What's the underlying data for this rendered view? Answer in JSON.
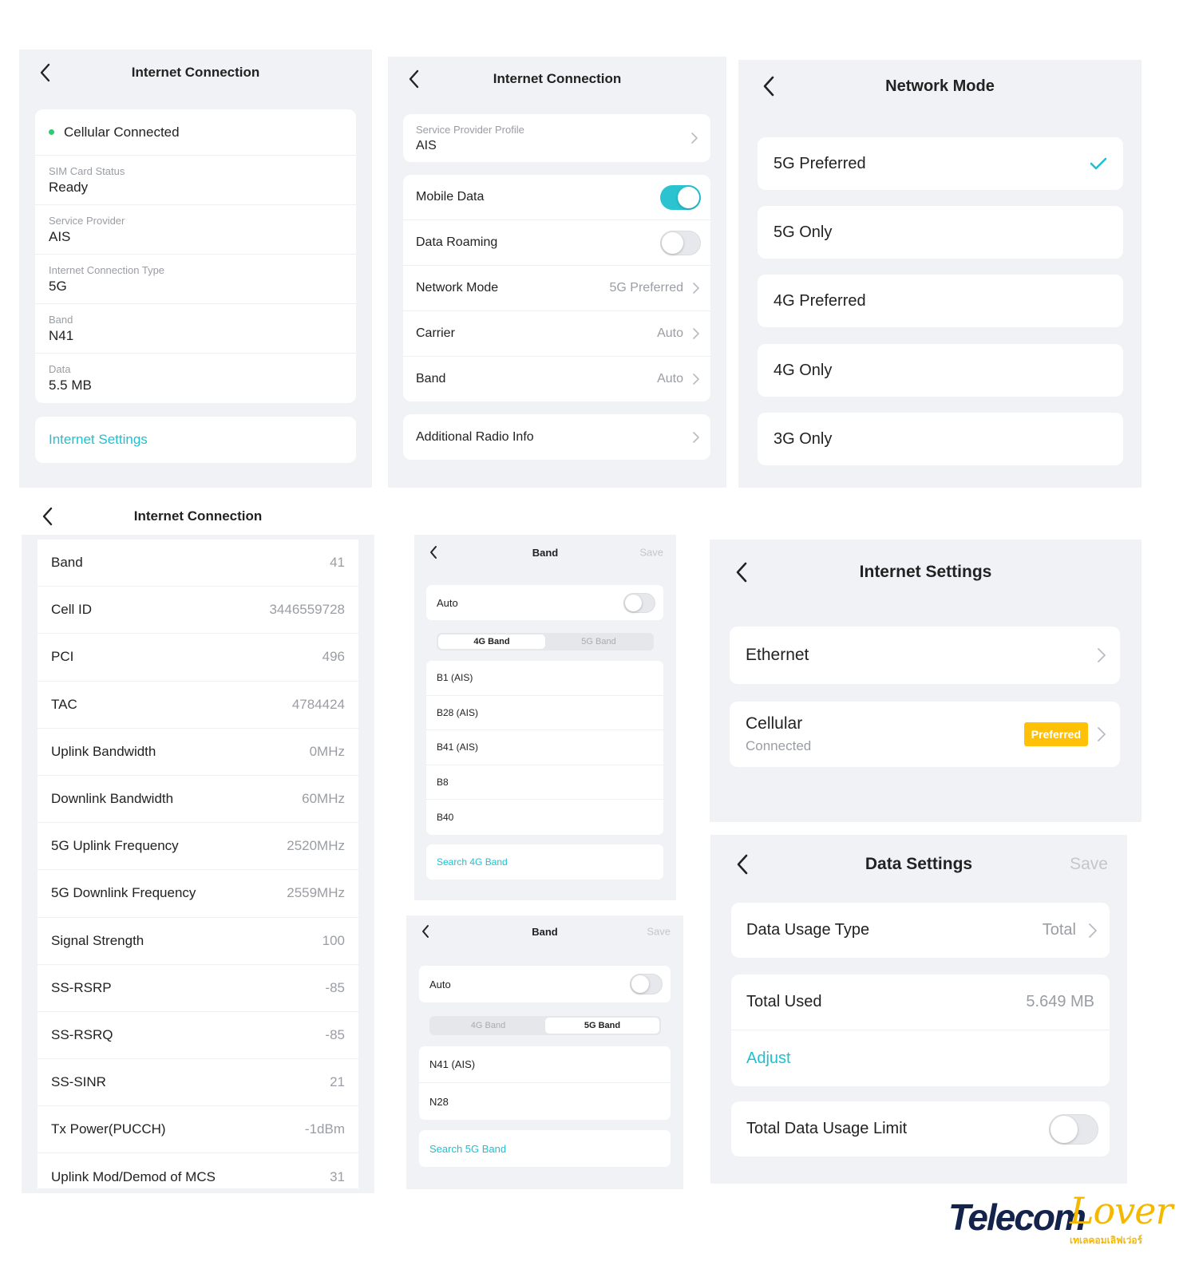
{
  "p1": {
    "title": "Internet Connection",
    "status": "Cellular Connected",
    "status_color": "#2ecc71",
    "fields": [
      {
        "label": "SIM Card Status",
        "value": "Ready"
      },
      {
        "label": "Service Provider",
        "value": "AIS"
      },
      {
        "label": "Internet Connection Type",
        "value": "5G"
      },
      {
        "label": "Band",
        "value": "N41"
      },
      {
        "label": "Data",
        "value": "5.5 MB"
      }
    ],
    "settings_link": "Internet Settings"
  },
  "p2": {
    "title": "Internet Connection",
    "profile_label": "Service Provider Profile",
    "profile_value": "AIS",
    "mobile_data": {
      "label": "Mobile Data",
      "on": true
    },
    "data_roaming": {
      "label": "Data Roaming",
      "on": false
    },
    "rows": [
      {
        "label": "Network Mode",
        "value": "5G Preferred"
      },
      {
        "label": "Carrier",
        "value": "Auto"
      },
      {
        "label": "Band",
        "value": "Auto"
      }
    ],
    "radio_info": "Additional Radio Info"
  },
  "p3": {
    "title": "Network Mode",
    "options": [
      "5G Preferred",
      "5G Only",
      "4G Preferred",
      "4G Only",
      "3G Only"
    ],
    "selected": "5G Preferred"
  },
  "p4": {
    "title": "Internet Connection",
    "rows": [
      {
        "label": "Band",
        "value": "41"
      },
      {
        "label": "Cell ID",
        "value": "3446559728"
      },
      {
        "label": "PCI",
        "value": "496"
      },
      {
        "label": "TAC",
        "value": "4784424"
      },
      {
        "label": "Uplink Bandwidth",
        "value": "0MHz"
      },
      {
        "label": "Downlink Bandwidth",
        "value": "60MHz"
      },
      {
        "label": "5G Uplink Frequency",
        "value": "2520MHz"
      },
      {
        "label": "5G Downlink Frequency",
        "value": "2559MHz"
      },
      {
        "label": "Signal Strength",
        "value": "100"
      },
      {
        "label": "SS-RSRP",
        "value": "-85"
      },
      {
        "label": "SS-RSRQ",
        "value": "-85"
      },
      {
        "label": "SS-SINR",
        "value": "21"
      },
      {
        "label": "Tx Power(PUCCH)",
        "value": "-1dBm"
      },
      {
        "label": "Uplink Mod/Demod of MCS",
        "value": "31"
      }
    ]
  },
  "p5": {
    "title": "Band",
    "save": "Save",
    "auto": "Auto",
    "tab_4g": "4G Band",
    "tab_5g": "5G Band",
    "active_tab": "4G Band",
    "bands": [
      "B1 (AIS)",
      "B28 (AIS)",
      "B41 (AIS)",
      "B8",
      "B40"
    ],
    "search": "Search 4G Band"
  },
  "p6": {
    "title": "Band",
    "save": "Save",
    "auto": "Auto",
    "tab_4g": "4G Band",
    "tab_5g": "5G Band",
    "active_tab": "5G Band",
    "bands": [
      "N41 (AIS)",
      "N28"
    ],
    "search": "Search 5G Band"
  },
  "p7": {
    "title": "Internet Settings",
    "ethernet": "Ethernet",
    "cellular": "Cellular",
    "cellular_status": "Connected",
    "badge": "Preferred",
    "badge_color": "#ffc107"
  },
  "p8": {
    "title": "Data Settings",
    "save": "Save",
    "usage_type_label": "Data Usage Type",
    "usage_type_value": "Total",
    "total_used_label": "Total Used",
    "total_used_value": "5.649 MB",
    "adjust": "Adjust",
    "limit_label": "Total Data Usage Limit",
    "limit_on": false
  },
  "watermark": {
    "text_a": "Telecom",
    "text_b": "Lover",
    "subtitle": "เทเลคอมเลิฟเว่อร์"
  },
  "colors": {
    "accent": "#1fc1d0",
    "toggle_on": "#2bc3d0",
    "background": "#f1f2f6"
  }
}
